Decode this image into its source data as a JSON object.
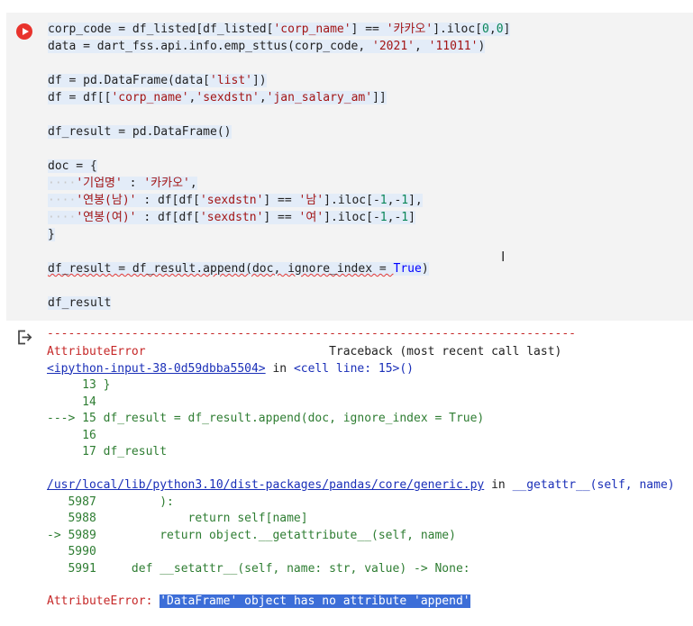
{
  "cell": {
    "code_lines": [
      "corp_code = df_listed[df_listed['corp_name'] == '카카오'].iloc[0,0]",
      "data = dart_fss.api.info.emp_sttus(corp_code, '2021', '11011')",
      "",
      "df = pd.DataFrame(data['list'])",
      "df = df[['corp_name','sexdstn','jan_salary_am']]",
      "",
      "df_result = pd.DataFrame()",
      "",
      "doc = {",
      "    '기업명' : '카카오',",
      "    '연봉(남)' : df[df['sexdstn'] == '남'].iloc[-1,-1],",
      "    '연봉(여)' : df[df['sexdstn'] == '여'].iloc[-1,-1]",
      "}",
      "",
      "df_result = df_result.append(doc, ignore_index = True)",
      "",
      "df_result"
    ]
  },
  "output": {
    "separator": "---------------------------------------------------------------------------",
    "error_type": "AttributeError",
    "traceback_label": "Traceback (most recent call last)",
    "input_link": "<ipython-input-38-0d59dbba5504>",
    "in_word": "in",
    "cell_line": "<cell line: 15>()",
    "frame1": [
      "     13 }",
      "     14",
      "---> 15 df_result = df_result.append(doc, ignore_index = True)",
      "     16",
      "     17 df_result"
    ],
    "file_link": "/usr/local/lib/python3.10/dist-packages/pandas/core/generic.py",
    "func_name": "__getattr__(self, name)",
    "frame2": [
      "   5987         ):",
      "   5988             return self[name]",
      "-> 5989         return object.__getattribute__(self, name)",
      "   5990",
      "   5991     def __setattr__(self, name: str, value) -> None:"
    ],
    "final_error_label": "AttributeError:",
    "final_error_message": "'DataFrame' object has no attribute 'append'"
  },
  "icons": {
    "run": "run-cell-icon",
    "output": "output-toggle-icon"
  }
}
